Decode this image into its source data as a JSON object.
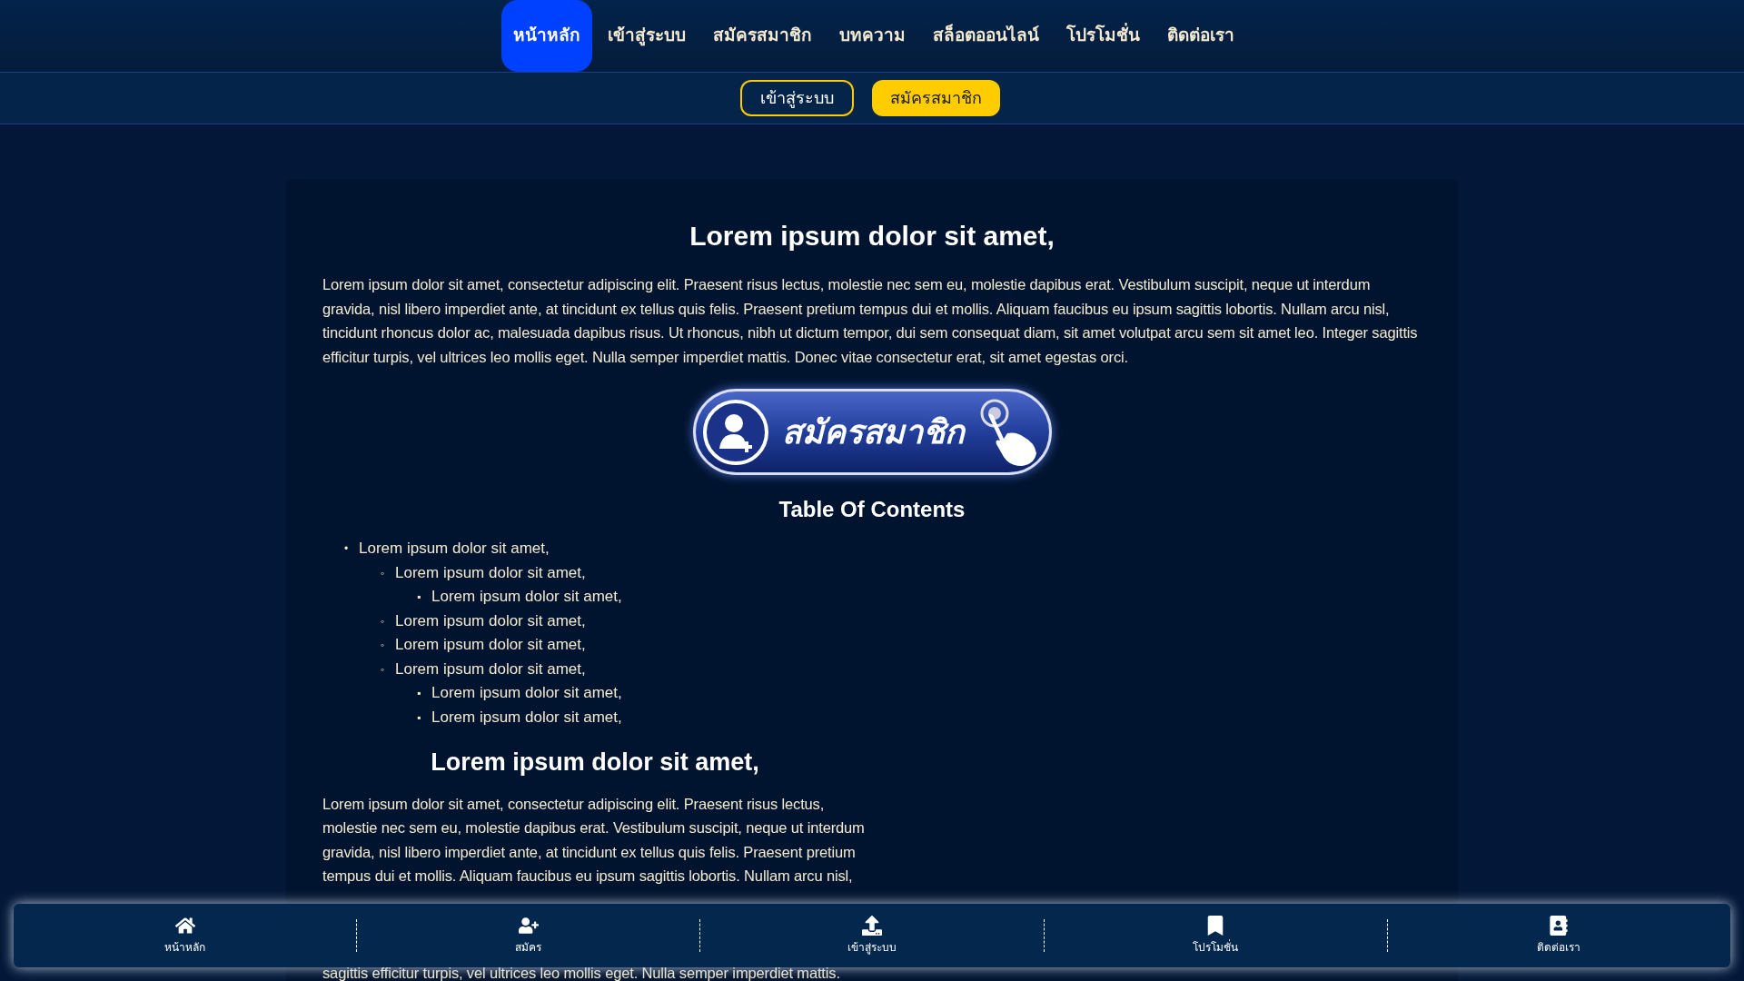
{
  "top_nav": {
    "items": [
      {
        "label": "หน้าหลัก",
        "selected": true
      },
      {
        "label": "เข้าสู่ระบบ",
        "selected": false
      },
      {
        "label": "สมัครสมาชิก",
        "selected": false
      },
      {
        "label": "บทความ",
        "selected": false
      },
      {
        "label": "สล็อตออนไลน์",
        "selected": false
      },
      {
        "label": "โปรโมชั่น",
        "selected": false
      },
      {
        "label": "ติดต่อเรา",
        "selected": false
      }
    ]
  },
  "auth_bar": {
    "login": "เข้าสู่ระบบ",
    "register": "สมัครสมาชิก"
  },
  "article": {
    "title": "Lorem ipsum dolor sit amet,",
    "intro": "Lorem ipsum dolor sit amet, consectetur adipiscing elit. Praesent risus lectus, molestie nec sem eu, molestie dapibus erat. Vestibulum suscipit, neque ut interdum gravida, nisl libero imperdiet ante, at tincidunt ex tellus quis felis. Praesent pretium tempus dui et mollis. Aliquam faucibus eu ipsum sagittis lobortis. Nullam arcu nisl, tincidunt rhoncus dolor ac, malesuada dapibus risus. Ut rhoncus, nibh ut dictum tempor, dui sem consequat diam, sit amet volutpat arcu sem sit amet leo. Integer sagittis efficitur turpis, vel ultrices leo mollis eget. Nulla semper imperdiet mattis. Donec vitae consectetur erat, sit amet egestas orci.",
    "banner": "สมัครสมาชิก",
    "toc_title": "Table Of Contents",
    "toc": [
      {
        "marker": "•",
        "text": "Lorem ipsum dolor sit amet,",
        "children": [
          {
            "marker": "◦",
            "text": "Lorem ipsum dolor sit amet,",
            "children": [
              {
                "marker": "▪",
                "text": "Lorem ipsum dolor sit amet,"
              }
            ]
          },
          {
            "marker": "◦",
            "text": "Lorem ipsum dolor sit amet,"
          },
          {
            "marker": "◦",
            "text": "Lorem ipsum dolor sit amet,"
          },
          {
            "marker": "◦",
            "text": "Lorem ipsum dolor sit amet,",
            "children": [
              {
                "marker": "▪",
                "text": "Lorem ipsum dolor sit amet,"
              },
              {
                "marker": "▪",
                "text": "Lorem ipsum dolor sit amet,"
              }
            ]
          }
        ]
      }
    ],
    "section_title": "Lorem ipsum dolor sit amet,",
    "section_text": "Lorem ipsum dolor sit amet, consectetur adipiscing elit. Praesent risus lectus, molestie nec sem eu, molestie dapibus erat. Vestibulum suscipit, neque ut interdum gravida, nisl libero imperdiet ante, at tincidunt ex tellus quis felis. Praesent pretium tempus dui et mollis. Aliquam faucibus eu ipsum sagittis lobortis. Nullam arcu nisl,",
    "section_tail": "sagittis efficitur turpis, vel ultrices leo mollis eget. Nulla semper imperdiet mattis."
  },
  "bottom_nav": [
    {
      "kind": "home",
      "label": "หน้าหลัก"
    },
    {
      "kind": "register",
      "label": "สมัคร"
    },
    {
      "kind": "login",
      "label": "เข้าสู่ระบบ"
    },
    {
      "kind": "promotion",
      "label": "โปรโมชั่น"
    },
    {
      "kind": "contact",
      "label": "ติดต่อเรา"
    }
  ]
}
